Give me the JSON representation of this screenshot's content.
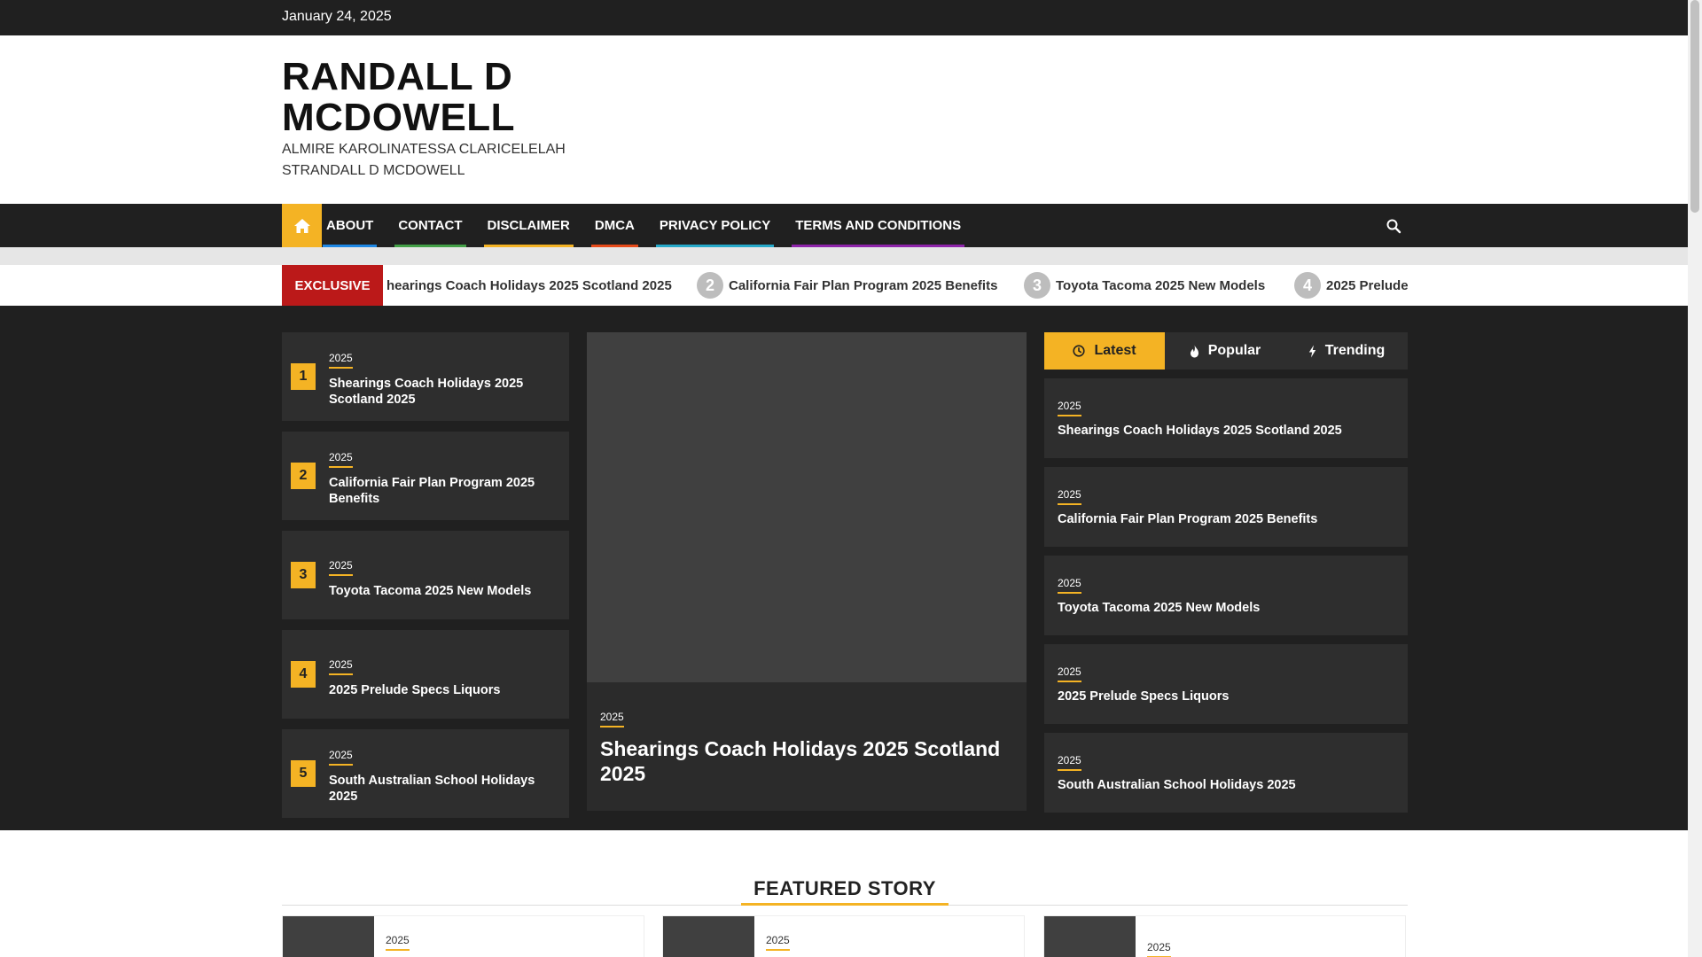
{
  "topbar": {
    "date": "January 24, 2025"
  },
  "header": {
    "title": "RANDALL D MCDOWELL",
    "tagline": "ALMIRE KAROLINATESSA CLARICELELAH STRANDALL D MCDOWELL"
  },
  "nav": {
    "items": [
      {
        "label": "ABOUT",
        "color": "#1e88e5"
      },
      {
        "label": "CONTACT",
        "color": "#43a047"
      },
      {
        "label": "DISCLAIMER",
        "color": "#f4b324"
      },
      {
        "label": "DMCA",
        "color": "#e64a19"
      },
      {
        "label": "PRIVACY POLICY",
        "color": "#26a9c9"
      },
      {
        "label": "TERMS AND CONDITIONS",
        "color": "#8e24aa"
      }
    ]
  },
  "ticker": {
    "label": "EXCLUSIVE",
    "items": [
      {
        "num": "",
        "title": "hearings Coach Holidays 2025 Scotland 2025"
      },
      {
        "num": "2",
        "title": "California Fair Plan Program 2025 Benefits"
      },
      {
        "num": "3",
        "title": "Toyota Tacoma 2025 New Models"
      },
      {
        "num": "4",
        "title": "2025 Prelude S"
      }
    ]
  },
  "left_list": [
    {
      "num": "1",
      "category": "2025",
      "title": "Shearings Coach Holidays 2025 Scotland 2025"
    },
    {
      "num": "2",
      "category": "2025",
      "title": "California Fair Plan Program 2025 Benefits"
    },
    {
      "num": "3",
      "category": "2025",
      "title": "Toyota Tacoma 2025 New Models"
    },
    {
      "num": "4",
      "category": "2025",
      "title": "2025 Prelude Specs Liquors"
    },
    {
      "num": "5",
      "category": "2025",
      "title": "South Australian School Holidays 2025"
    }
  ],
  "feature": {
    "category": "2025",
    "title": "Shearings Coach Holidays 2025 Scotland 2025"
  },
  "tabs": [
    {
      "label": "Latest",
      "icon": "clock-icon"
    },
    {
      "label": "Popular",
      "icon": "fire-icon"
    },
    {
      "label": "Trending",
      "icon": "bolt-icon"
    }
  ],
  "side_list": [
    {
      "category": "2025",
      "title": "Shearings Coach Holidays 2025 Scotland 2025"
    },
    {
      "category": "2025",
      "title": "California Fair Plan Program 2025 Benefits"
    },
    {
      "category": "2025",
      "title": "Toyota Tacoma 2025 New Models"
    },
    {
      "category": "2025",
      "title": "2025 Prelude Specs Liquors"
    },
    {
      "category": "2025",
      "title": "South Australian School Holidays 2025"
    }
  ],
  "featured_story": {
    "heading": "FEATURED STORY",
    "cards": [
      {
        "category": "2025"
      },
      {
        "category": "2025"
      },
      {
        "category": "2025"
      }
    ]
  },
  "colors": {
    "accent": "#f4b324",
    "exclusive": "#bb1919",
    "dark": "#202020"
  }
}
